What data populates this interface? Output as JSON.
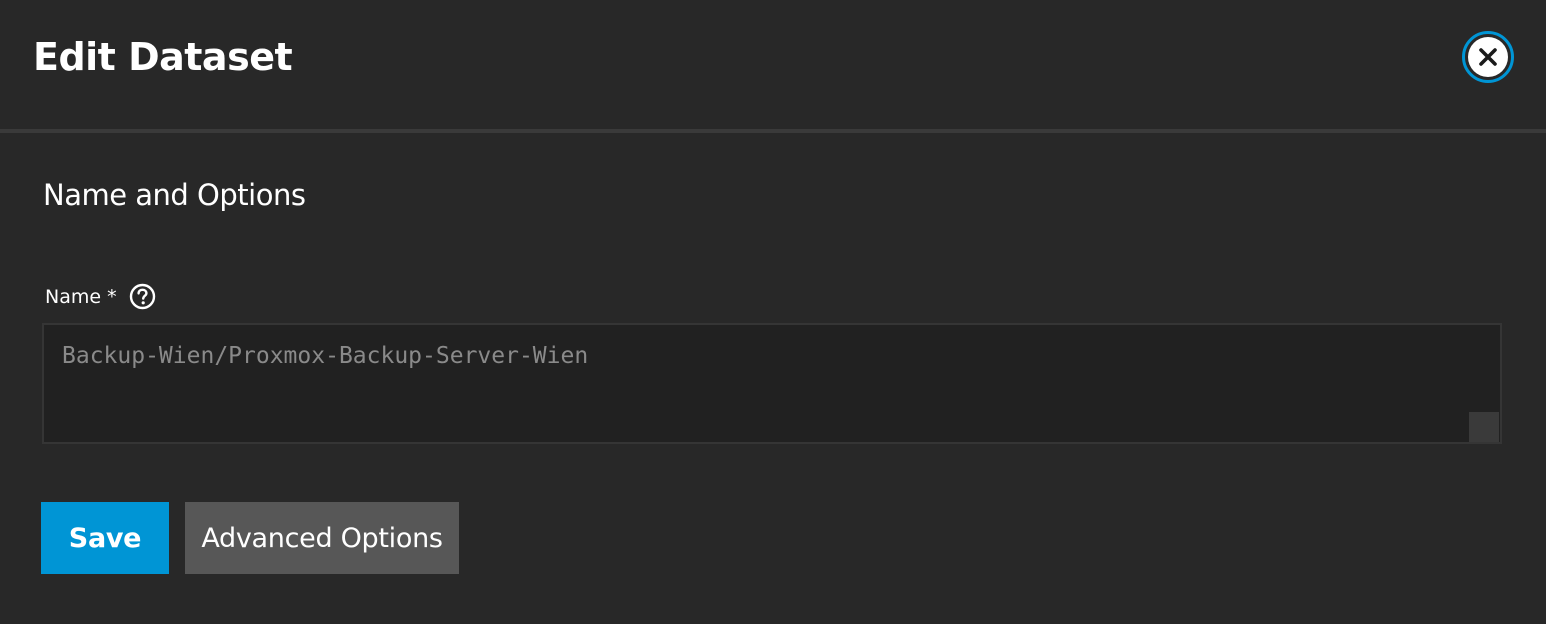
{
  "dialog": {
    "title": "Edit Dataset",
    "close_icon": "close-circle-icon"
  },
  "section": {
    "title": "Name and Options"
  },
  "name_field": {
    "label": "Name",
    "required_marker": "*",
    "help_icon": "help-circle-icon",
    "value": "Backup-Wien/Proxmox-Backup-Server-Wien"
  },
  "actions": {
    "save_label": "Save",
    "advanced_label": "Advanced Options"
  },
  "colors": {
    "background": "#282828",
    "accent": "#0095d5",
    "secondary_button": "#575757",
    "input_background": "#212121"
  }
}
